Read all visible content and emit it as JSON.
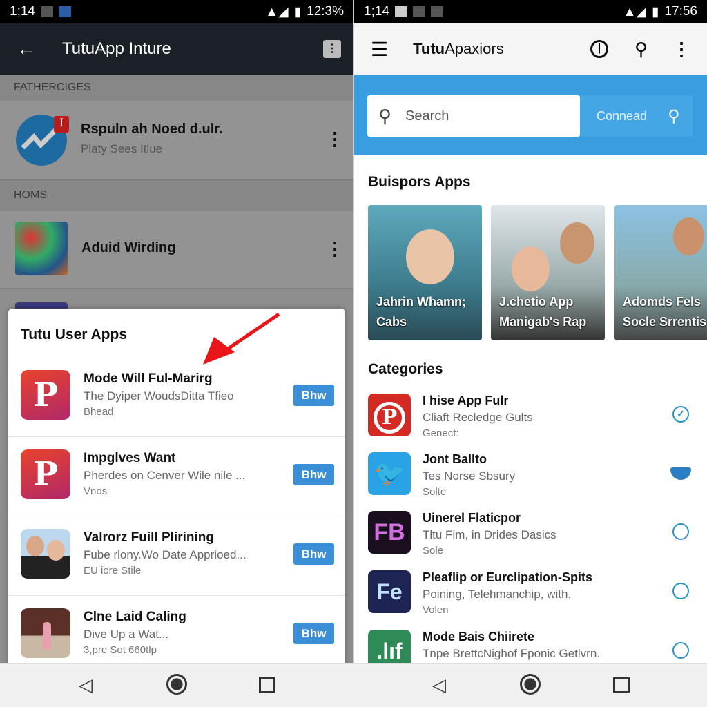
{
  "left": {
    "status": {
      "left_text": "1;14",
      "right_text": "12:3%"
    },
    "appbar": {
      "title": "TutuApp Inture"
    },
    "sections": [
      {
        "header": "FATHERCIGES",
        "item": {
          "title": "Rspuln ah Noed d.ulr.",
          "subtitle": "Platy Sees Itlue",
          "badge": "I"
        }
      },
      {
        "header": "HOMS",
        "item": {
          "title": "Aduid Wirding"
        }
      }
    ],
    "modal": {
      "title": "Tutu User Apps",
      "items": [
        {
          "title": "Mode Will Ful-Marirg",
          "subtitle": "The Dyiper WoudsDitta Tfieo",
          "meta": "Bhead",
          "button": "Bhw",
          "icon": "pinterest-icon"
        },
        {
          "title": "Impglves Want",
          "subtitle": "Pherdes on Cenver Wile nile  ...",
          "meta": "Vnos",
          "button": "Bhw",
          "icon": "pinterest-icon"
        },
        {
          "title": "Valrorz Fuill Plirining",
          "subtitle": "Fube rlony.Wo Date Apprioed...",
          "meta": "EU iore Stile",
          "button": "Bhw",
          "icon": "couple-photo"
        },
        {
          "title": "Clne Laid Caling",
          "subtitle": "Dive Up a Wat...",
          "meta": "3,pre Sot 660tlp",
          "button": "Bhw",
          "icon": "dancer-photo"
        }
      ]
    }
  },
  "right": {
    "status": {
      "left_text": "1;14",
      "right_text": "17:56"
    },
    "appbar": {
      "title_bold": "Tutu",
      "title_rest": "Apaxiors"
    },
    "search": {
      "placeholder": "Search",
      "action": "Connead"
    },
    "featured": {
      "heading": "Buispors Apps",
      "cards": [
        {
          "line1": "Jahrin Whamn;",
          "line2": "Cabs"
        },
        {
          "line1": "J.chetio App",
          "line2": "Manigab's Rap"
        },
        {
          "line1": "Adomds Fels",
          "line2": "Socle Srrentis"
        }
      ]
    },
    "categories": {
      "heading": "Categories",
      "items": [
        {
          "title": "I hise App Fulr",
          "subtitle": "Cliaft Recledge Gults",
          "meta": "Genect:",
          "icon": "pinterest-icon",
          "state": "checked"
        },
        {
          "title": "Jont Ballto",
          "subtitle": "Tes Norse Sbsury",
          "meta": "Solte",
          "icon": "twitter-icon",
          "state": "partial"
        },
        {
          "title": "Uinerel Flaticpor",
          "subtitle": "Tltu Fim, in Drides Dasics",
          "meta": "Sole",
          "icon": "fb-logo-icon",
          "state": "unchecked"
        },
        {
          "title": "Pleaflip or Eurclipation-Spits",
          "subtitle": "Poining, Telehmanchip, with.",
          "meta": "Volen",
          "icon": "fe-icon",
          "state": "unchecked"
        },
        {
          "title": "Mode Bais Chiirete",
          "subtitle": "Tnpe BrettcNighof Fponic Getlvrn.",
          "meta": "",
          "icon": "chart-app-icon",
          "state": "unchecked"
        }
      ]
    }
  },
  "colors": {
    "accent_blue": "#3a9de0",
    "button_blue": "#3a8fd6",
    "annotation_arrow": "#e8161b"
  }
}
